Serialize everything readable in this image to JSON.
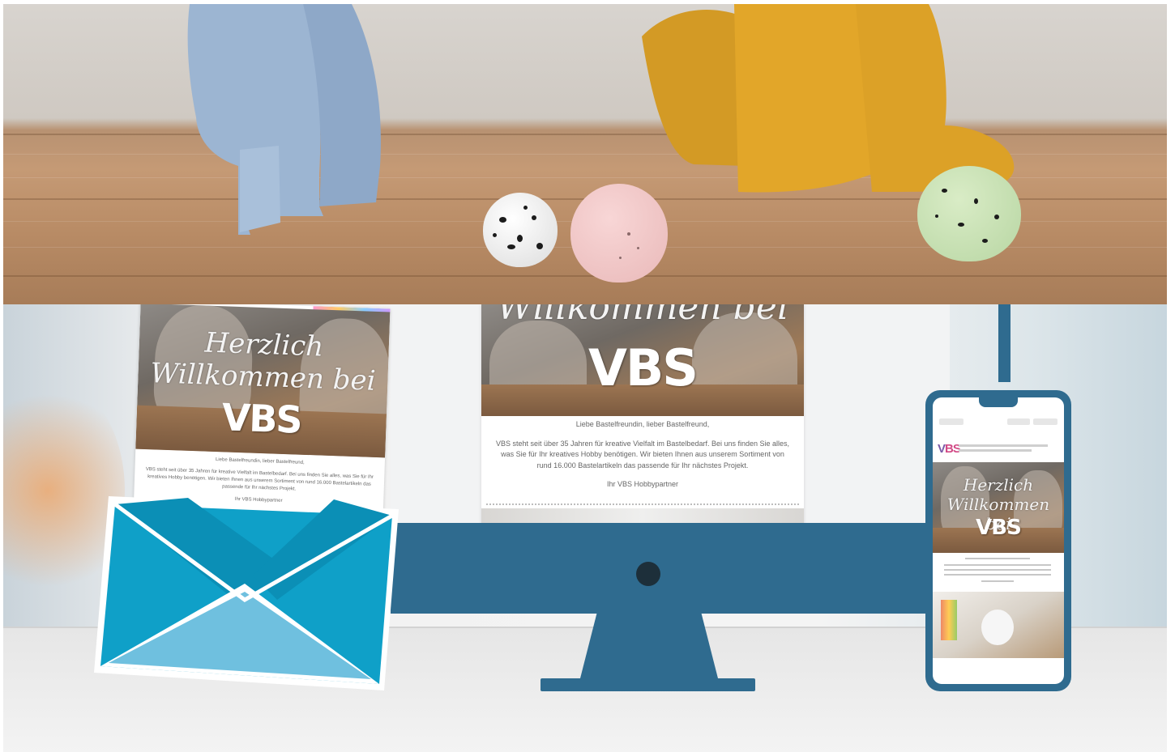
{
  "letter": {
    "headline_line1": "Herzlich",
    "headline_line2": "Willkommen bei",
    "logo": "VBS",
    "salutation": "Liebe Bastelfreundin, lieber Bastelfreund,",
    "body": "VBS steht seit über 35 Jahren für kreative Vielfalt im Bastelbedarf. Bei uns finden Sie alles, was Sie für Ihr kreatives Hobby benötigen. Wir bieten Ihnen aus unserem Sortiment von rund 16.000 Bastelartikeln das passende für Ihr nächstes Projekt.",
    "signature": "Ihr VBS Hobbypartner"
  },
  "desktop": {
    "headline": "Willkommen bei",
    "logo": "VBS",
    "salutation": "Liebe Bastelfreundin, lieber Bastelfreund,",
    "body": "VBS steht seit über 35 Jahren für kreative Vielfalt im Bastelbedarf. Bei uns finden Sie alles, was Sie für Ihr kreatives Hobby benötigen. Wir bieten Ihnen aus unserem Sortiment von rund 16.000 Bastelartikeln das passende für Ihr nächstes Projekt.",
    "signature": "Ihr VBS Hobbypartner"
  },
  "phone": {
    "logo_v": "V",
    "logo_bs": "BS",
    "headline_line1": "Herzlich",
    "headline_line2": "Willkommen bei",
    "logo": "VBS"
  },
  "colors": {
    "device_blue": "#2f6b8f",
    "envelope_blue": "#0fa0c8",
    "envelope_light": "#6fc0df"
  }
}
